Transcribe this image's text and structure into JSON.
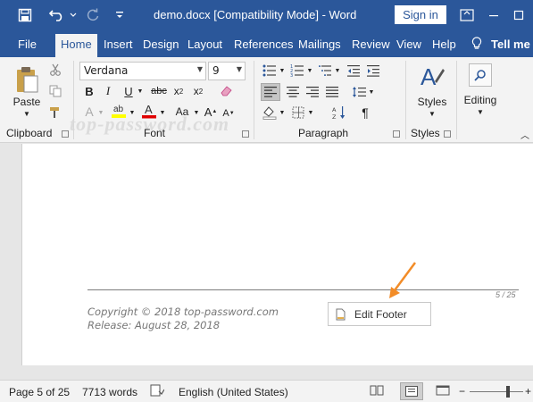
{
  "title_bar": {
    "document_title": "demo.docx [Compatibility Mode]  -  Word",
    "sign_in_label": "Sign in",
    "icons": [
      "save-icon",
      "undo-icon",
      "redo-icon",
      "customize-qat-icon",
      "ribbon-display-options-icon",
      "minimize-icon",
      "maximize-icon",
      "close-icon"
    ]
  },
  "tabs": [
    "File",
    "Home",
    "Insert",
    "Design",
    "Layout",
    "References",
    "Mailings",
    "Review",
    "View",
    "Help"
  ],
  "active_tab": "Home",
  "tell_me_label": "Tell me",
  "ribbon": {
    "clipboard": {
      "group_label": "Clipboard",
      "paste_label": "Paste"
    },
    "font": {
      "group_label": "Font",
      "font_name": "Verdana",
      "font_size": "9"
    },
    "paragraph": {
      "group_label": "Paragraph"
    },
    "styles": {
      "group_label": "Styles",
      "styles_label": "Styles"
    },
    "editing": {
      "editing_label": "Editing"
    }
  },
  "watermark": "top-password.com",
  "document": {
    "page_number_text": "5 / 25",
    "footer_line1": "Copyright © 2018 top-password.com",
    "footer_line2": "Release: August 28, 2018",
    "edit_footer_label": "Edit Footer"
  },
  "status_bar": {
    "page": "Page 5 of 25",
    "words": "7713 words",
    "language": "English (United States)"
  },
  "colors": {
    "title_bar": "#2b579a",
    "ribbon_bg": "#f3f3f3",
    "arrow": "#f28c28",
    "highlight": "#ffff00",
    "font_color_bar": "#e00000"
  }
}
